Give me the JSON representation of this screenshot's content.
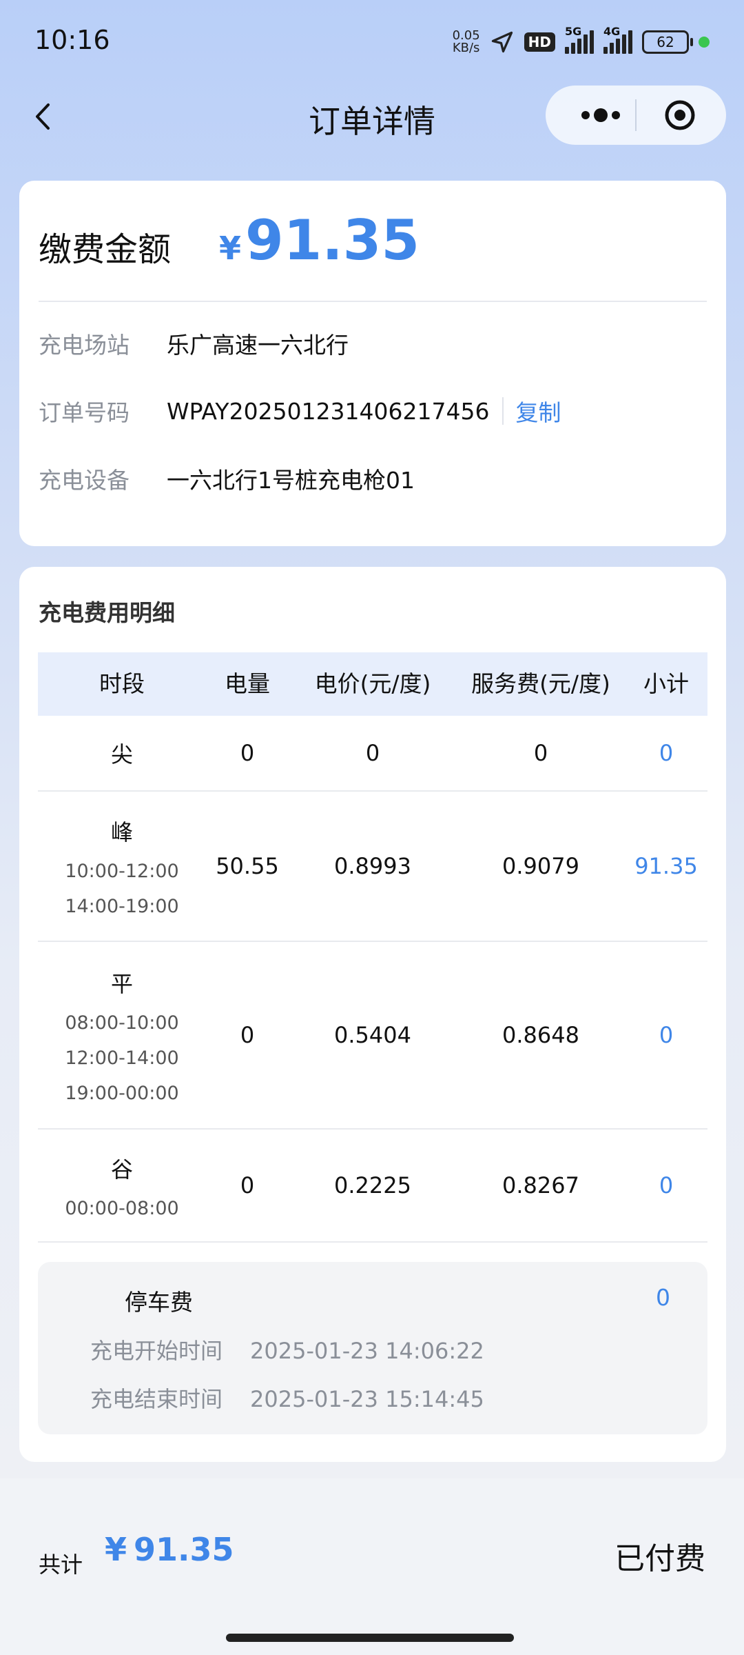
{
  "status_bar": {
    "time": "10:16",
    "net_speed_value": "0.05",
    "net_speed_unit": "KB/s",
    "hd": "HD",
    "signal1_label": "5G",
    "signal2_label": "4G",
    "battery": "62"
  },
  "nav": {
    "title": "订单详情",
    "back_icon": "chevron-left-icon",
    "more_icon": "more-dots-icon",
    "close_icon": "target-icon"
  },
  "summary": {
    "amount_label": "缴费金额",
    "currency": "¥",
    "amount": "91.35",
    "rows": [
      {
        "label": "充电场站",
        "value": "乐广高速一六北行"
      },
      {
        "label": "订单号码",
        "value": "WPAY20250123140621​7456",
        "action": "复制"
      },
      {
        "label": "充电设备",
        "value": "一六北行1号桩充电枪01"
      }
    ]
  },
  "detail": {
    "title": "充电费用明细",
    "headers": [
      "时段",
      "电量",
      "电价(元/度)",
      "服务费(元/度)",
      "小计"
    ],
    "rows": [
      {
        "period": "尖",
        "times": [],
        "energy": "0",
        "price": "0",
        "service": "0",
        "subtotal": "0"
      },
      {
        "period": "峰",
        "times": [
          "10:00-12:00",
          "14:00-19:00"
        ],
        "energy": "50.55",
        "price": "0.8993",
        "service": "0.9079",
        "subtotal": "91.35"
      },
      {
        "period": "平",
        "times": [
          "08:00-10:00",
          "12:00-14:00",
          "19:00-00:00"
        ],
        "energy": "0",
        "price": "0.5404",
        "service": "0.8648",
        "subtotal": "0"
      },
      {
        "period": "谷",
        "times": [
          "00:00-08:00"
        ],
        "energy": "0",
        "price": "0.2225",
        "service": "0.8267",
        "subtotal": "0"
      }
    ],
    "parking": {
      "label": "停车费",
      "value": "0",
      "start_label": "充电开始时间",
      "start_time": "2025-01-23 14:06:22",
      "end_label": "充电结束时间",
      "end_time": "2025-01-23 15:14:45"
    }
  },
  "footer": {
    "total_label": "共计",
    "currency": "¥",
    "total": "91.35",
    "status": "已付费"
  },
  "colors": {
    "accent": "#3f86e8",
    "table_header_bg": "#e7eefc"
  }
}
